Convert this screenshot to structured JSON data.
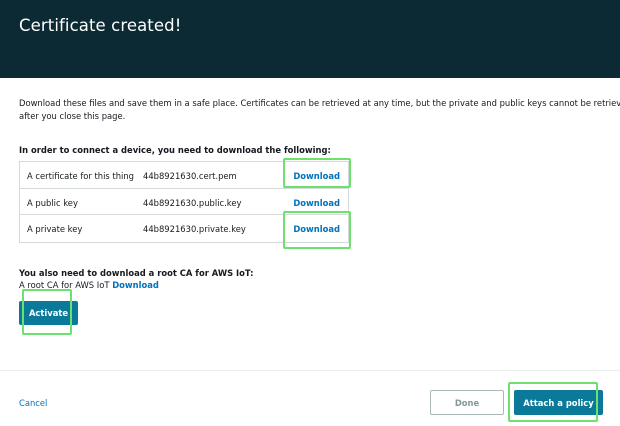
{
  "header": {
    "title": "Certificate created!"
  },
  "intro": {
    "line1": "Download these files and save them in a safe place. Certificates can be retrieved at any time, but the private and public keys cannot be retrieved",
    "line2": "after you close this page."
  },
  "files": {
    "heading": "In order to connect a device, you need to download the following:",
    "rows": [
      {
        "label": "A certificate for this thing",
        "file": "44b8921630.cert.pem",
        "action": "Download"
      },
      {
        "label": "A public key",
        "file": "44b8921630.public.key",
        "action": "Download"
      },
      {
        "label": "A private key",
        "file": "44b8921630.private.key",
        "action": "Download"
      }
    ]
  },
  "root_ca": {
    "heading": "You also need to download a root CA for AWS IoT:",
    "label": "A root CA for AWS IoT",
    "action": "Download"
  },
  "activate_label": "Activate",
  "footer": {
    "cancel_label": "Cancel",
    "done_label": "Done",
    "attach_label": "Attach a policy"
  },
  "colors": {
    "header_bg": "#0b2a33",
    "primary_button": "#0b7a9a",
    "link": "#0073bb",
    "highlight": "#6de06d"
  }
}
